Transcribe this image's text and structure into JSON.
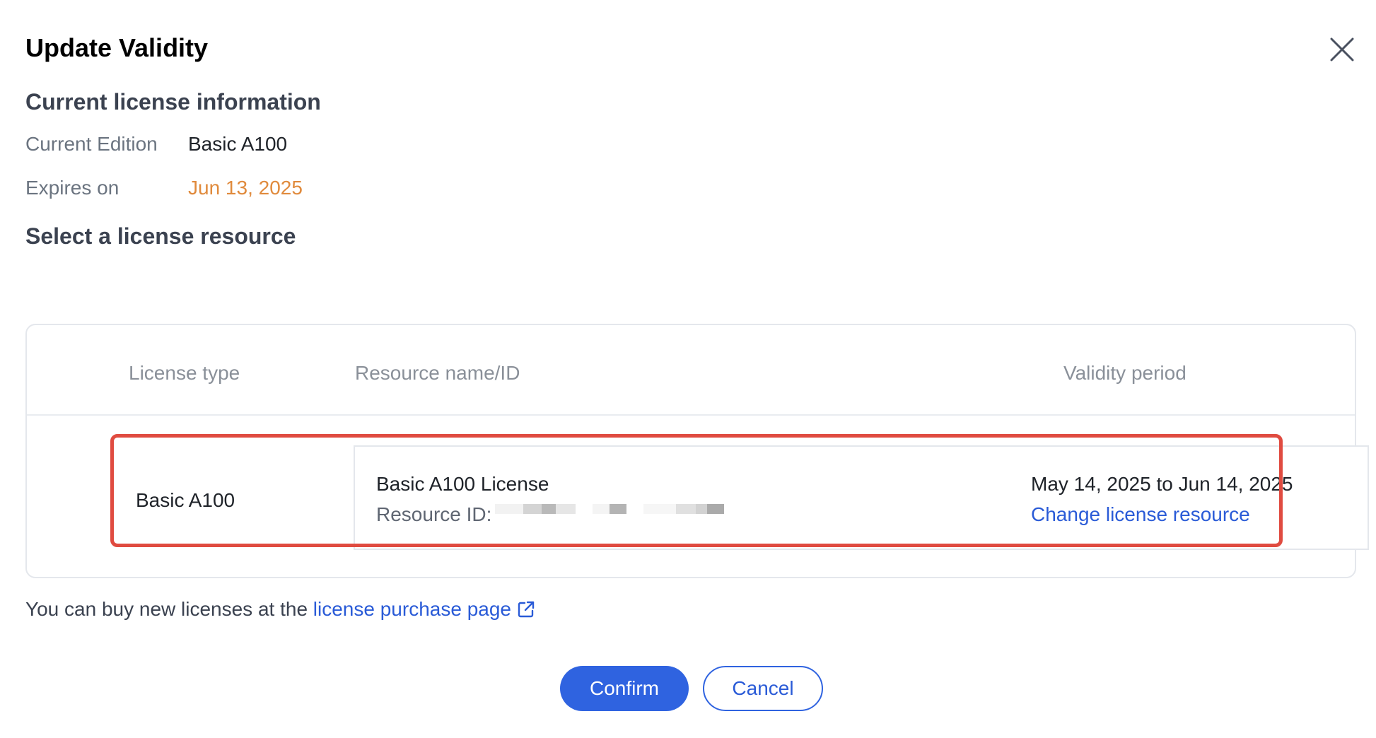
{
  "dialog": {
    "title": "Update Validity"
  },
  "current_license": {
    "section_title": "Current license information",
    "edition_label": "Current Edition",
    "edition_value": "Basic A100",
    "expires_label": "Expires on",
    "expires_value": "Jun 13, 2025"
  },
  "resource_selection": {
    "section_title": "Select a license resource",
    "columns": [
      "License type",
      "Resource name/ID",
      "Validity period"
    ],
    "row": {
      "license_type": "Basic A100",
      "resource_name": "Basic A100 License",
      "resource_id_label": "Resource ID:",
      "validity_period": "May 14, 2025 to Jun 14, 2025",
      "change_link": "Change license resource"
    }
  },
  "footer": {
    "note_prefix": "You can buy new licenses at the ",
    "purchase_link": "license purchase page"
  },
  "actions": {
    "confirm_label": "Confirm",
    "cancel_label": "Cancel"
  },
  "colors": {
    "primary": "#2f63e0",
    "link": "#2a5bd7",
    "expiry_warning": "#e08a3c",
    "highlight_frame": "#e04b40"
  },
  "icons": {
    "close": "close-icon",
    "external_link": "external-link-icon"
  }
}
